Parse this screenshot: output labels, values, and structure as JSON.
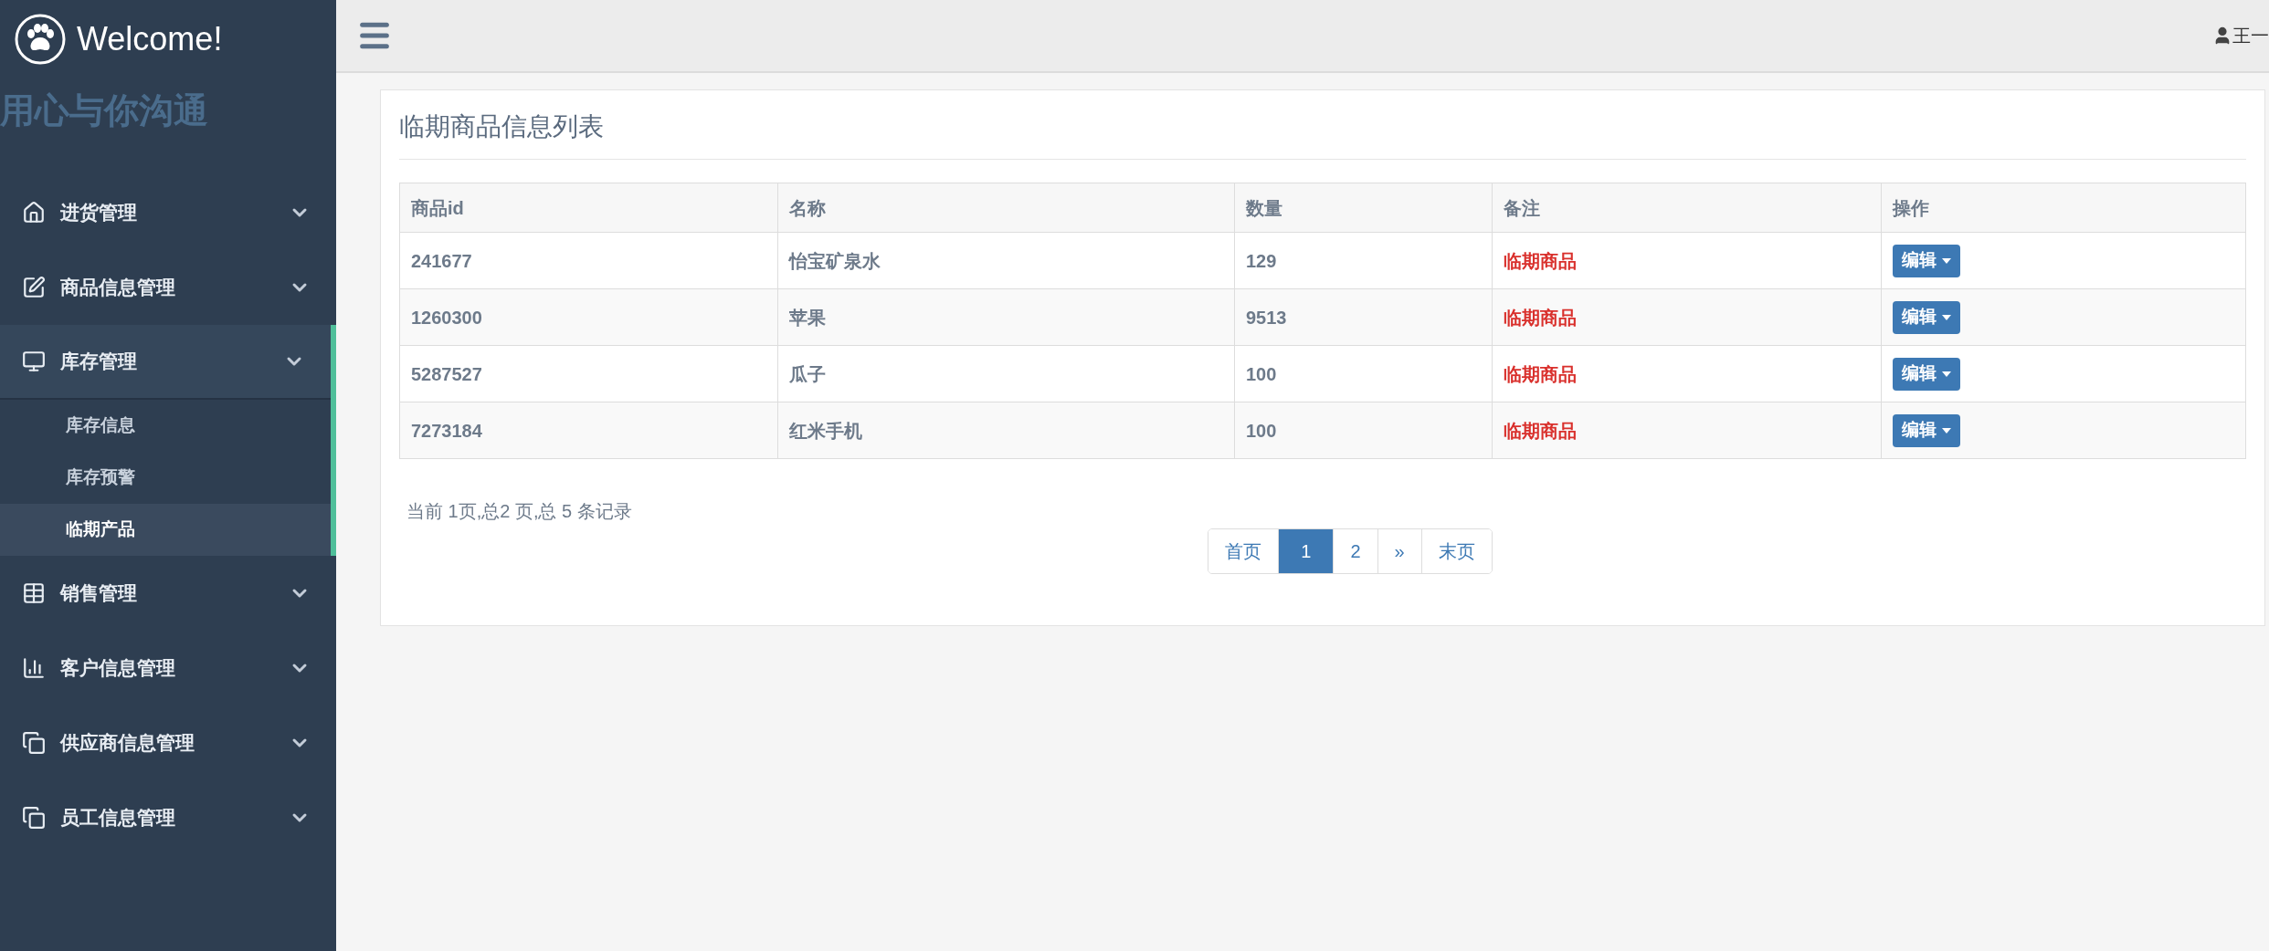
{
  "brand": {
    "title": "Welcome!",
    "slogan": "用心与你沟通"
  },
  "sidebar": {
    "items": [
      {
        "kind": "home",
        "label": "进货管理",
        "expanded": false
      },
      {
        "kind": "edit",
        "label": "商品信息管理",
        "expanded": false
      },
      {
        "kind": "monitor",
        "label": "库存管理",
        "expanded": true,
        "children": [
          {
            "label": "库存信息",
            "selected": false
          },
          {
            "label": "库存预警",
            "selected": false
          },
          {
            "label": "临期产品",
            "selected": true
          }
        ]
      },
      {
        "kind": "table",
        "label": "销售管理",
        "expanded": false
      },
      {
        "kind": "chart",
        "label": "客户信息管理",
        "expanded": false
      },
      {
        "kind": "copy",
        "label": "供应商信息管理",
        "expanded": false
      },
      {
        "kind": "copy",
        "label": "员工信息管理",
        "expanded": false
      }
    ]
  },
  "topbar": {
    "user": "王一"
  },
  "panel": {
    "title": "临期商品信息列表"
  },
  "table": {
    "columns": [
      "商品id",
      "名称",
      "数量",
      "备注",
      "操作"
    ],
    "rows": [
      {
        "id": "241677",
        "name": "怡宝矿泉水",
        "qty": "129",
        "note": "临期商品",
        "action": "编辑"
      },
      {
        "id": "1260300",
        "name": "苹果",
        "qty": "9513",
        "note": "临期商品",
        "action": "编辑"
      },
      {
        "id": "5287527",
        "name": "瓜子",
        "qty": "100",
        "note": "临期商品",
        "action": "编辑"
      },
      {
        "id": "7273184",
        "name": "红米手机",
        "qty": "100",
        "note": "临期商品",
        "action": "编辑"
      }
    ]
  },
  "pagination": {
    "summary": "当前 1页,总2 页,总 5 条记录",
    "pages": [
      {
        "label": "首页",
        "selected": false
      },
      {
        "label": "1",
        "selected": true
      },
      {
        "label": "2",
        "selected": false
      },
      {
        "label": "»",
        "selected": false
      },
      {
        "label": "末页",
        "selected": false
      }
    ]
  }
}
